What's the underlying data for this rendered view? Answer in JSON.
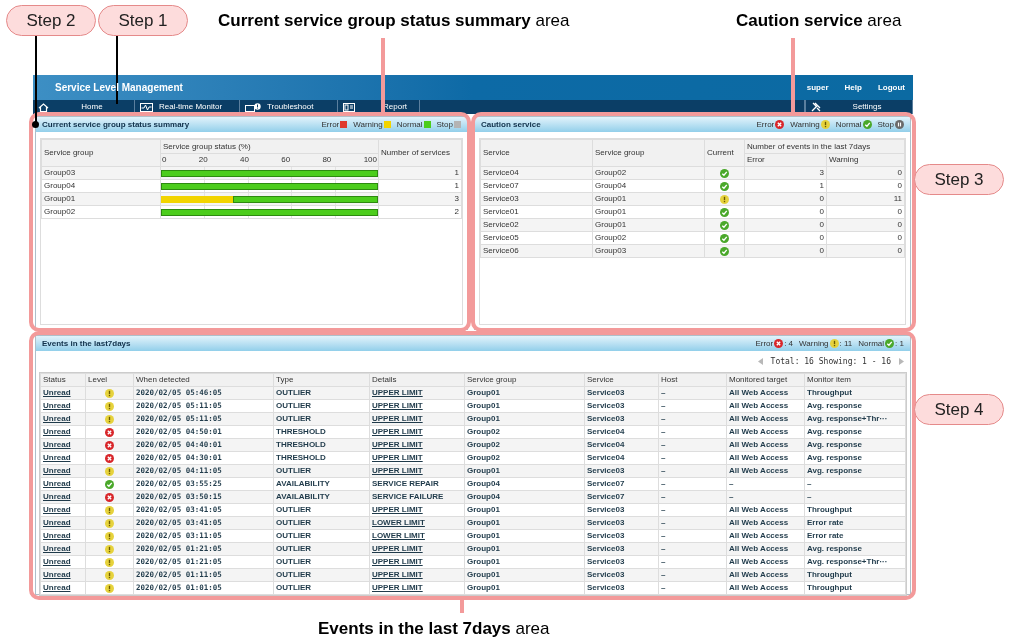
{
  "annotations": {
    "steps": [
      {
        "label": "Step 2"
      },
      {
        "label": "Step 1"
      },
      {
        "label": "Step 3"
      },
      {
        "label": "Step 4"
      }
    ],
    "area_labels": [
      "**Current service group status summary** area",
      "**Caution service** area",
      "**Events in the last 7days** area"
    ]
  },
  "header": {
    "title": "Service Level Management",
    "links": [
      "super",
      "Help",
      "Logout"
    ]
  },
  "nav": [
    {
      "label": "Home"
    },
    {
      "label": "Real-time Monitor"
    },
    {
      "label": "Troubleshoot"
    },
    {
      "label": "Report"
    },
    {
      "label": "Settings"
    }
  ],
  "summary": {
    "title": "Current service group status summary",
    "legend": [
      {
        "label": "Error",
        "color": "#e03a2e"
      },
      {
        "label": "Warning",
        "color": "#f2d400"
      },
      {
        "label": "Normal",
        "color": "#4ccd1c"
      },
      {
        "label": "Stop",
        "color": "#b4b4b4"
      }
    ],
    "columns": [
      "Service group",
      "Service group status (%)",
      "Number of services"
    ],
    "ticks": [
      "0",
      "20",
      "40",
      "60",
      "80",
      "100"
    ],
    "rows": [
      {
        "group": "Group03",
        "count": "1",
        "segments": [
          {
            "kind": "normal",
            "level": 1
          }
        ]
      },
      {
        "group": "Group04",
        "count": "1",
        "segments": [
          {
            "kind": "normal",
            "level": 1
          }
        ]
      },
      {
        "group": "Group01",
        "count": "3",
        "segments": [
          {
            "kind": "warning",
            "level": 0.33
          },
          {
            "kind": "normal",
            "level": 0.67
          }
        ]
      },
      {
        "group": "Group02",
        "count": "2",
        "segments": [
          {
            "kind": "normal",
            "level": 1
          }
        ]
      }
    ]
  },
  "caution": {
    "title": "Caution service",
    "legend": [
      {
        "label": "Error",
        "kind": "error"
      },
      {
        "label": "Warning",
        "kind": "warning"
      },
      {
        "label": "Normal",
        "kind": "normal"
      },
      {
        "label": "Stop",
        "kind": "stop"
      }
    ],
    "columns": [
      "Service",
      "Service group",
      "Current"
    ],
    "group_header": "Number of events in the last 7days",
    "sub_columns": [
      "Error",
      "Warning"
    ],
    "rows": [
      {
        "service": "Service04",
        "group": "Group02",
        "current": {
          "kind": "normal"
        },
        "error": "3",
        "warning": "0"
      },
      {
        "service": "Service07",
        "group": "Group04",
        "current": {
          "kind": "normal"
        },
        "error": "1",
        "warning": "0"
      },
      {
        "service": "Service03",
        "group": "Group01",
        "current": {
          "kind": "warning"
        },
        "error": "0",
        "warning": "11"
      },
      {
        "service": "Service01",
        "group": "Group01",
        "current": {
          "kind": "normal"
        },
        "error": "0",
        "warning": "0"
      },
      {
        "service": "Service02",
        "group": "Group01",
        "current": {
          "kind": "normal"
        },
        "error": "0",
        "warning": "0"
      },
      {
        "service": "Service05",
        "group": "Group02",
        "current": {
          "kind": "normal"
        },
        "error": "0",
        "warning": "0"
      },
      {
        "service": "Service06",
        "group": "Group03",
        "current": {
          "kind": "normal"
        },
        "error": "0",
        "warning": "0"
      }
    ]
  },
  "events": {
    "title": "Events in the last7days",
    "counts": [
      {
        "label": "Error",
        "kind": "error",
        "value": ": 4"
      },
      {
        "label": "Warning",
        "kind": "warning",
        "value": ": 11"
      },
      {
        "label": "Normal",
        "kind": "normal",
        "value": ": 1"
      }
    ],
    "pager": {
      "text": "Total: 16 Showing: 1 - 16",
      "prev_disabled": true,
      "next_disabled": true
    },
    "columns": [
      "Status",
      "Level",
      "When detected",
      "Type",
      "Details",
      "Service group",
      "Service",
      "Host",
      "Monitored target",
      "Monitor item"
    ],
    "rows": [
      {
        "status": "Unread",
        "severity": {
          "kind": "warning"
        },
        "detected": "2020/02/05 05:46:05",
        "type": "OUTLIER",
        "details": "UPPER LIMIT",
        "link": true,
        "group": "Group01",
        "service": "Service03",
        "host": "–",
        "target": "All Web Access",
        "item": "Throughput"
      },
      {
        "status": "Unread",
        "severity": {
          "kind": "warning"
        },
        "detected": "2020/02/05 05:11:05",
        "type": "OUTLIER",
        "details": "UPPER LIMIT",
        "link": true,
        "group": "Group01",
        "service": "Service03",
        "host": "–",
        "target": "All Web Access",
        "item": "Avg. response"
      },
      {
        "status": "Unread",
        "severity": {
          "kind": "warning"
        },
        "detected": "2020/02/05 05:11:05",
        "type": "OUTLIER",
        "details": "UPPER LIMIT",
        "link": true,
        "group": "Group01",
        "service": "Service03",
        "host": "–",
        "target": "All Web Access",
        "item": "Avg. response+Thr···"
      },
      {
        "status": "Unread",
        "severity": {
          "kind": "error"
        },
        "detected": "2020/02/05 04:50:01",
        "type": "THRESHOLD",
        "details": "UPPER LIMIT",
        "link": true,
        "group": "Group02",
        "service": "Service04",
        "host": "–",
        "target": "All Web Access",
        "item": "Avg. response"
      },
      {
        "status": "Unread",
        "severity": {
          "kind": "error"
        },
        "detected": "2020/02/05 04:40:01",
        "type": "THRESHOLD",
        "details": "UPPER LIMIT",
        "link": true,
        "group": "Group02",
        "service": "Service04",
        "host": "–",
        "target": "All Web Access",
        "item": "Avg. response"
      },
      {
        "status": "Unread",
        "severity": {
          "kind": "error"
        },
        "detected": "2020/02/05 04:30:01",
        "type": "THRESHOLD",
        "details": "UPPER LIMIT",
        "link": true,
        "group": "Group02",
        "service": "Service04",
        "host": "–",
        "target": "All Web Access",
        "item": "Avg. response"
      },
      {
        "status": "Unread",
        "severity": {
          "kind": "warning"
        },
        "detected": "2020/02/05 04:11:05",
        "type": "OUTLIER",
        "details": "UPPER LIMIT",
        "link": true,
        "group": "Group01",
        "service": "Service03",
        "host": "–",
        "target": "All Web Access",
        "item": "Avg. response"
      },
      {
        "status": "Unread",
        "severity": {
          "kind": "normal"
        },
        "detected": "2020/02/05 03:55:25",
        "type": "AVAILABILITY",
        "details": "SERVICE REPAIR",
        "link": false,
        "group": "Group04",
        "service": "Service07",
        "host": "–",
        "target": "–",
        "item": "–"
      },
      {
        "status": "Unread",
        "severity": {
          "kind": "error"
        },
        "detected": "2020/02/05 03:50:15",
        "type": "AVAILABILITY",
        "details": "SERVICE FAILURE",
        "link": false,
        "group": "Group04",
        "service": "Service07",
        "host": "–",
        "target": "–",
        "item": "–"
      },
      {
        "status": "Unread",
        "severity": {
          "kind": "warning"
        },
        "detected": "2020/02/05 03:41:05",
        "type": "OUTLIER",
        "details": "UPPER LIMIT",
        "link": true,
        "group": "Group01",
        "service": "Service03",
        "host": "–",
        "target": "All Web Access",
        "item": "Throughput"
      },
      {
        "status": "Unread",
        "severity": {
          "kind": "warning"
        },
        "detected": "2020/02/05 03:41:05",
        "type": "OUTLIER",
        "details": "LOWER LIMIT",
        "link": true,
        "group": "Group01",
        "service": "Service03",
        "host": "–",
        "target": "All Web Access",
        "item": "Error rate"
      },
      {
        "status": "Unread",
        "severity": {
          "kind": "warning"
        },
        "detected": "2020/02/05 03:11:05",
        "type": "OUTLIER",
        "details": "LOWER LIMIT",
        "link": true,
        "group": "Group01",
        "service": "Service03",
        "host": "–",
        "target": "All Web Access",
        "item": "Error rate"
      },
      {
        "status": "Unread",
        "severity": {
          "kind": "warning"
        },
        "detected": "2020/02/05 01:21:05",
        "type": "OUTLIER",
        "details": "UPPER LIMIT",
        "link": true,
        "group": "Group01",
        "service": "Service03",
        "host": "–",
        "target": "All Web Access",
        "item": "Avg. response"
      },
      {
        "status": "Unread",
        "severity": {
          "kind": "warning"
        },
        "detected": "2020/02/05 01:21:05",
        "type": "OUTLIER",
        "details": "UPPER LIMIT",
        "link": true,
        "group": "Group01",
        "service": "Service03",
        "host": "–",
        "target": "All Web Access",
        "item": "Avg. response+Thr···"
      },
      {
        "status": "Unread",
        "severity": {
          "kind": "warning"
        },
        "detected": "2020/02/05 01:11:05",
        "type": "OUTLIER",
        "details": "UPPER LIMIT",
        "link": true,
        "group": "Group01",
        "service": "Service03",
        "host": "–",
        "target": "All Web Access",
        "item": "Throughput"
      },
      {
        "status": "Unread",
        "severity": {
          "kind": "warning"
        },
        "detected": "2020/02/05 01:01:05",
        "type": "OUTLIER",
        "details": "UPPER LIMIT",
        "link": true,
        "group": "Group01",
        "service": "Service03",
        "host": "–",
        "target": "All Web Access",
        "item": "Throughput"
      }
    ]
  }
}
